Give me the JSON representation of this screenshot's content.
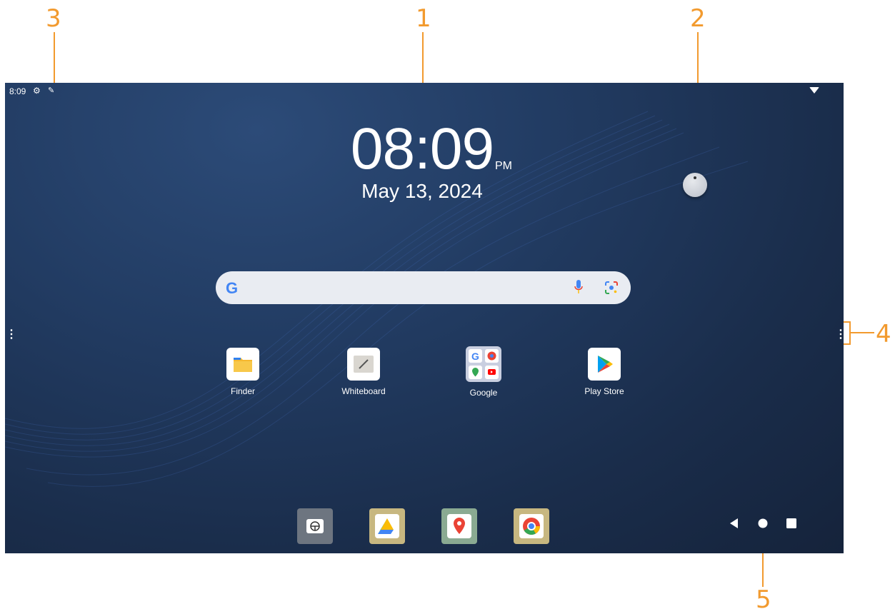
{
  "callouts": [
    "1",
    "2",
    "3",
    "4",
    "5"
  ],
  "status_bar": {
    "time": "8:09"
  },
  "clock": {
    "time": "08:09",
    "ampm": "PM",
    "date": "May 13, 2024"
  },
  "search": {
    "logo": "G"
  },
  "apps": [
    {
      "label": "Finder",
      "icon": "folder-icon"
    },
    {
      "label": "Whiteboard",
      "icon": "whiteboard-icon"
    },
    {
      "label": "Google",
      "icon": "google-folder-icon"
    },
    {
      "label": "Play Store",
      "icon": "play-store-icon"
    }
  ],
  "dock": [
    "steering-wheel-icon",
    "drive-icon",
    "maps-icon",
    "chrome-icon"
  ],
  "nav_bar": [
    "back",
    "home",
    "recents"
  ],
  "colors": {
    "callout": "#f29a2e",
    "background": "#1f3557"
  }
}
